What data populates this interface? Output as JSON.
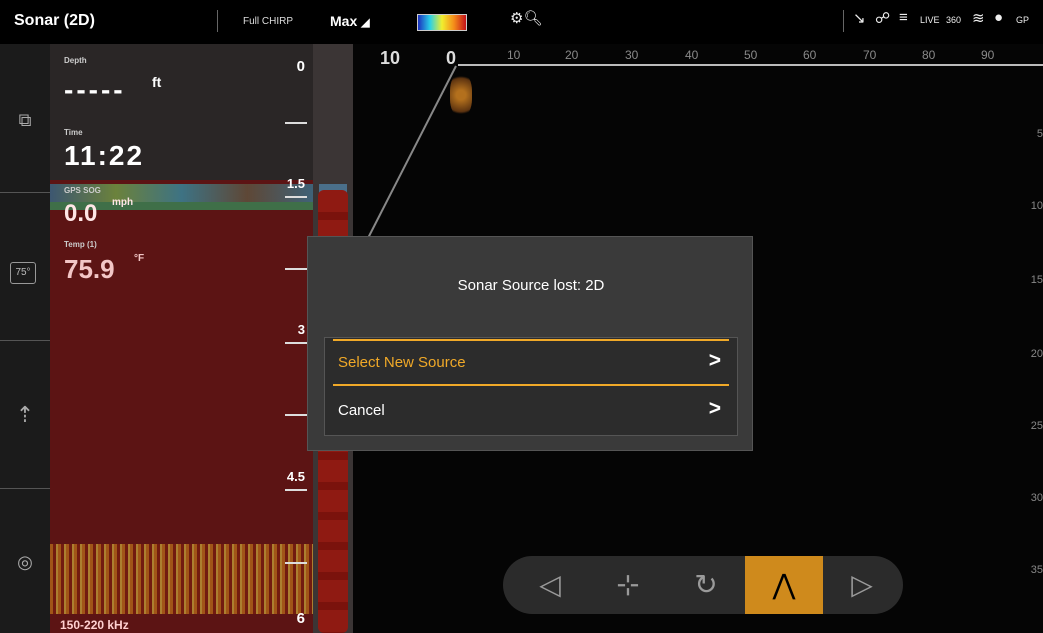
{
  "topbar": {
    "title": "Sonar (2D)",
    "chirp": "Full CHIRP",
    "max": "Max",
    "status_icons": [
      "cursor-icon",
      "network-icon",
      "chart-layers-icon",
      "live-icon",
      "360-icon",
      "fish-icon",
      "compass-icon",
      "gps-icon"
    ]
  },
  "panel": {
    "depth_label": "Depth",
    "depth_value": "-----",
    "depth_unit": "ft",
    "time_label": "Time",
    "time_value": "11:22",
    "sog_label": "GPS SOG",
    "sog_value": "0.0",
    "sog_unit": "mph",
    "temp_label": "Temp (1)",
    "temp_value": "75.9",
    "temp_unit": "°F",
    "frequency": "150-220 kHz",
    "depth_scale": [
      "0",
      "1.5",
      "3",
      "4.5",
      "6"
    ]
  },
  "left_rail": {
    "icons": [
      "windows-icon",
      "temperature-icon",
      "boat-icon",
      "sonar-icon"
    ],
    "temp_chip": "75°"
  },
  "main": {
    "left_scale": "10",
    "zero": "0",
    "range_scale": [
      "10",
      "20",
      "30",
      "40",
      "50",
      "60",
      "70",
      "80",
      "90"
    ],
    "right_scale": [
      "5",
      "10",
      "15",
      "20",
      "25",
      "30",
      "35"
    ]
  },
  "dialog": {
    "title": "Sonar Source lost:  2D",
    "select_label": "Select New Source",
    "cancel_label": "Cancel",
    "arrow": ">"
  },
  "bottom_nav": {
    "items": [
      "back-icon",
      "cursor-target-icon",
      "rotate-view-icon",
      "heading-up-icon",
      "forward-icon"
    ],
    "active_index": 3
  },
  "colors": {
    "accent": "#f0a928",
    "sonar_red": "#5c1414",
    "dialog_bg": "#3a3a3a",
    "active_nav": "#cf8a1c"
  }
}
